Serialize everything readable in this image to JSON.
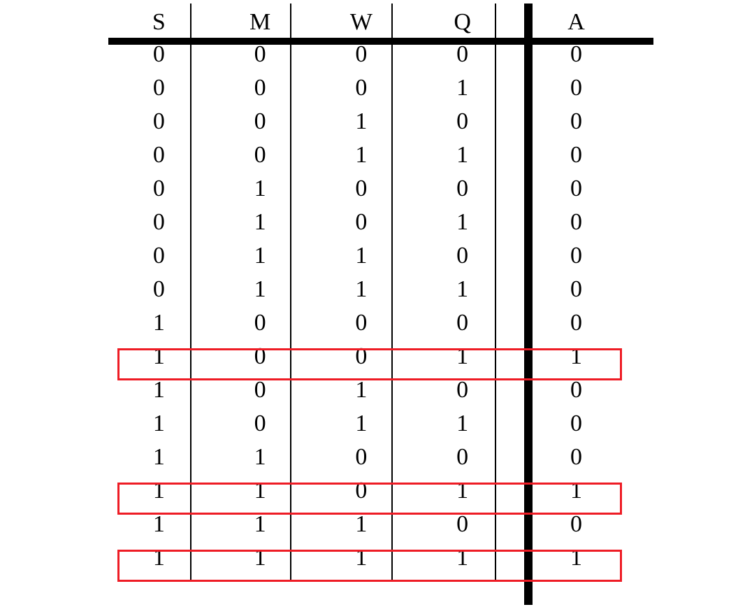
{
  "headers": [
    "S",
    "M",
    "W",
    "Q",
    "A"
  ],
  "rows": [
    {
      "S": "0",
      "M": "0",
      "W": "0",
      "Q": "0",
      "A": "0",
      "hl": false
    },
    {
      "S": "0",
      "M": "0",
      "W": "0",
      "Q": "1",
      "A": "0",
      "hl": false
    },
    {
      "S": "0",
      "M": "0",
      "W": "1",
      "Q": "0",
      "A": "0",
      "hl": false
    },
    {
      "S": "0",
      "M": "0",
      "W": "1",
      "Q": "1",
      "A": "0",
      "hl": false
    },
    {
      "S": "0",
      "M": "1",
      "W": "0",
      "Q": "0",
      "A": "0",
      "hl": false
    },
    {
      "S": "0",
      "M": "1",
      "W": "0",
      "Q": "1",
      "A": "0",
      "hl": false
    },
    {
      "S": "0",
      "M": "1",
      "W": "1",
      "Q": "0",
      "A": "0",
      "hl": false
    },
    {
      "S": "0",
      "M": "1",
      "W": "1",
      "Q": "1",
      "A": "0",
      "hl": false
    },
    {
      "S": "1",
      "M": "0",
      "W": "0",
      "Q": "0",
      "A": "0",
      "hl": false
    },
    {
      "S": "1",
      "M": "0",
      "W": "0",
      "Q": "1",
      "A": "1",
      "hl": true
    },
    {
      "S": "1",
      "M": "0",
      "W": "1",
      "Q": "0",
      "A": "0",
      "hl": false
    },
    {
      "S": "1",
      "M": "0",
      "W": "1",
      "Q": "1",
      "A": "0",
      "hl": false
    },
    {
      "S": "1",
      "M": "1",
      "W": "0",
      "Q": "0",
      "A": "0",
      "hl": false
    },
    {
      "S": "1",
      "M": "1",
      "W": "0",
      "Q": "1",
      "A": "1",
      "hl": true
    },
    {
      "S": "1",
      "M": "1",
      "W": "1",
      "Q": "0",
      "A": "0",
      "hl": false
    },
    {
      "S": "1",
      "M": "1",
      "W": "1",
      "Q": "1",
      "A": "1",
      "hl": true
    }
  ]
}
